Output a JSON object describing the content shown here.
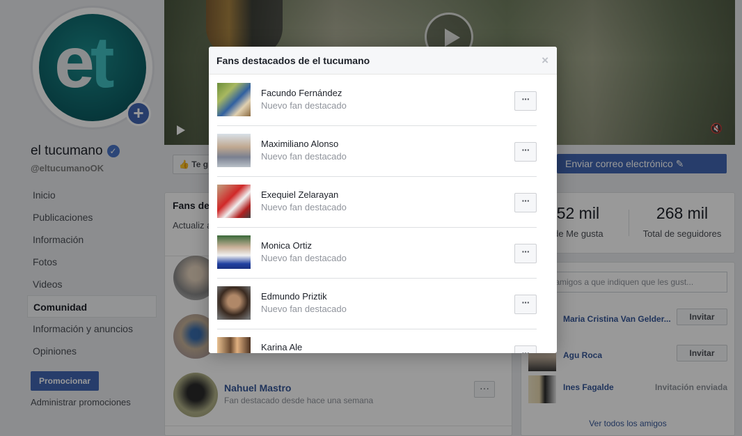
{
  "profile": {
    "name": "el tucumano",
    "handle": "@eltucumanoOK",
    "logo_text_e": "e",
    "logo_text_t": "t"
  },
  "sidebar": {
    "items": [
      {
        "label": "Inicio"
      },
      {
        "label": "Publicaciones"
      },
      {
        "label": "Información"
      },
      {
        "label": "Fotos"
      },
      {
        "label": "Videos"
      },
      {
        "label": "Comunidad",
        "active": true
      },
      {
        "label": "Información y anuncios"
      },
      {
        "label": "Opiniones"
      }
    ],
    "promote_label": "Promocionar",
    "manage_promotions_label": "Administrar promociones"
  },
  "action_bar": {
    "like_label": "Te g",
    "email_label": "Enviar correo electrónico"
  },
  "fans_card": {
    "title": "Fans de",
    "description": "Actualiz administ",
    "visible_fan": {
      "name": "Nahuel Mastro",
      "subtitle": "Fan destacado desde hace una semana"
    },
    "more_label": "···"
  },
  "stats": {
    "likes_value": "252 mil",
    "likes_label": "al de Me gusta",
    "followers_value": "268 mil",
    "followers_label": "Total de seguidores"
  },
  "friends": {
    "search_placeholder": "a tus amigos a que indiquen que les gust...",
    "rows": [
      {
        "name": "Maria Cristina Van Gelder...",
        "action": "Invitar"
      },
      {
        "name": "Agu Roca",
        "action": "Invitar"
      },
      {
        "name": "Ines Fagalde",
        "action": "Invitación enviada"
      }
    ],
    "see_all_label": "Ver todos los amigos"
  },
  "dialog": {
    "title": "Fans destacados de el tucumano",
    "close_label": "×",
    "more_label": "···",
    "fans": [
      {
        "name": "Facundo Fernández",
        "subtitle": "Nuevo fan destacado"
      },
      {
        "name": "Maximiliano Alonso",
        "subtitle": "Nuevo fan destacado"
      },
      {
        "name": "Exequiel Zelarayan",
        "subtitle": "Nuevo fan destacado"
      },
      {
        "name": "Monica Ortiz",
        "subtitle": "Nuevo fan destacado"
      },
      {
        "name": "Edmundo Priztik",
        "subtitle": "Nuevo fan destacado"
      },
      {
        "name": "Karina Ale",
        "subtitle": ""
      }
    ]
  },
  "colors": {
    "facebook_blue": "#4267b2",
    "link_blue": "#365899",
    "background": "#e9ebee",
    "logo_teal": "#0c5d63",
    "logo_accent": "#41c1c3"
  }
}
